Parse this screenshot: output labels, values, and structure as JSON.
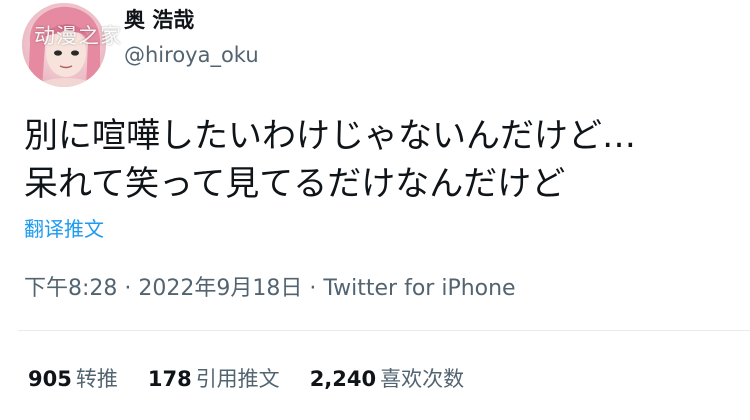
{
  "profile": {
    "display_name": "奥 浩哉",
    "handle": "@hiroya_oku",
    "watermark": "动漫之家"
  },
  "tweet": {
    "lines": [
      "別に喧嘩したいわけじゃないんだけど…",
      "呆れて笑って見てるだけなんだけど"
    ],
    "translate_label": "翻译推文"
  },
  "meta": {
    "time": "下午8:28",
    "separator": " · ",
    "date": "2022年9月18日",
    "client": "Twitter for iPhone"
  },
  "stats": {
    "retweets": {
      "count": "905",
      "label": "转推"
    },
    "quotes": {
      "count": "178",
      "label": "引用推文"
    },
    "likes": {
      "count": "2,240",
      "label": "喜欢次数"
    }
  },
  "colors": {
    "text": "#0f1419",
    "secondary": "#536471",
    "link": "#1d9bf0",
    "divider": "#e6ecf0"
  }
}
